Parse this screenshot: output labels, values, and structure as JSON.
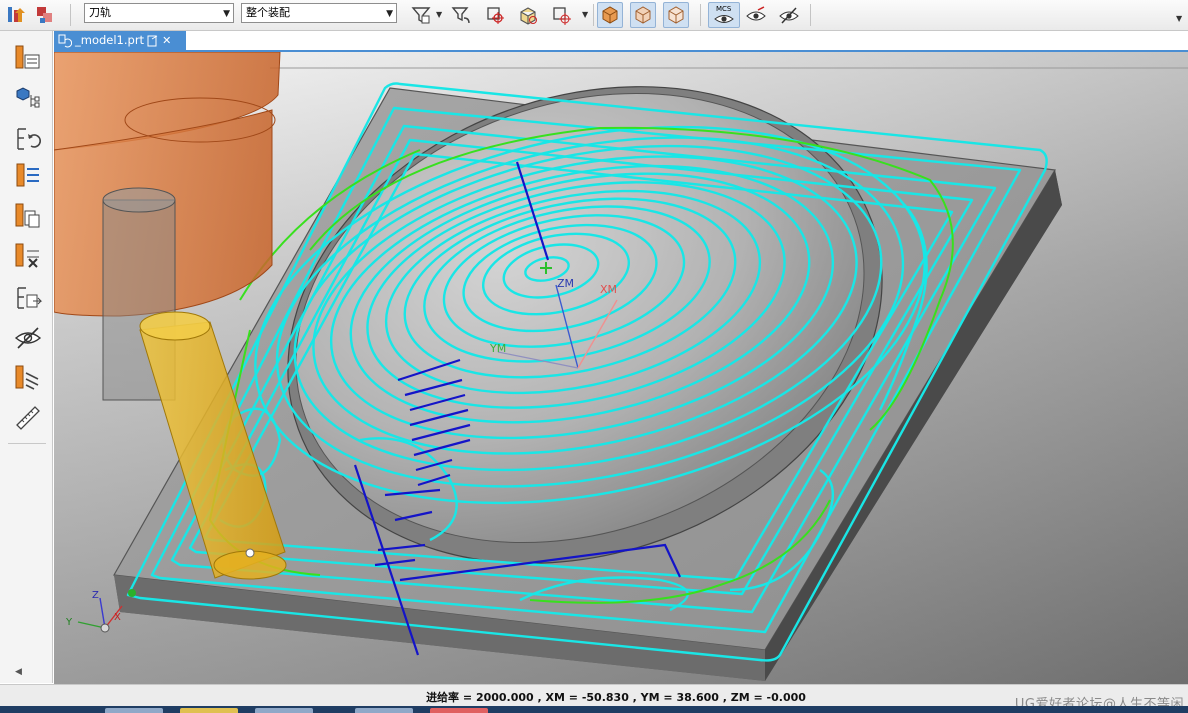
{
  "toolbar": {
    "filter_combo": "刀轨",
    "scope_combo": "整个装配",
    "mcs_label": "MCS"
  },
  "tab": {
    "title": "_model1.prt",
    "close_glyph": "✕"
  },
  "viewport": {
    "zm_label": "ZM",
    "xm_label": "XM",
    "ym_label": "YM",
    "triad_z": "Z",
    "triad_y": "Y",
    "triad_x": "X"
  },
  "status": {
    "text": "进给率 = 2000.000 , XM = -50.830 , YM = 38.600 , ZM = -0.000",
    "watermark": "UG爱好者论坛@人生不等闲"
  },
  "icons": {
    "toolbar": [
      "operation-navigator-icon",
      "group-icon",
      "filter-icon",
      "deselect-filter-icon",
      "snap-point-icon",
      "select-body-icon",
      "point-on-face-icon",
      "view-shaded-icon",
      "view-wireframe-icon",
      "view-box-icon",
      "mcs-view-icon",
      "show-hide-icon",
      "hide-icon"
    ],
    "leftbar": [
      "create-program-icon",
      "assembly-navigator-icon",
      "replay-toolpath-icon",
      "generate-toolpath-icon",
      "verify-toolpath-icon",
      "delete-toolpath-icon",
      "postprocess-icon",
      "hide-toolpath-icon",
      "tool-library-icon",
      "measure-icon"
    ]
  },
  "colors": {
    "toolpath": "#19e6e6",
    "engage": "#1414c8",
    "cut-region": "#38e01e",
    "tool": "#e8b420",
    "holder": "#e07030",
    "accent-tab": "#4a8ed3"
  }
}
